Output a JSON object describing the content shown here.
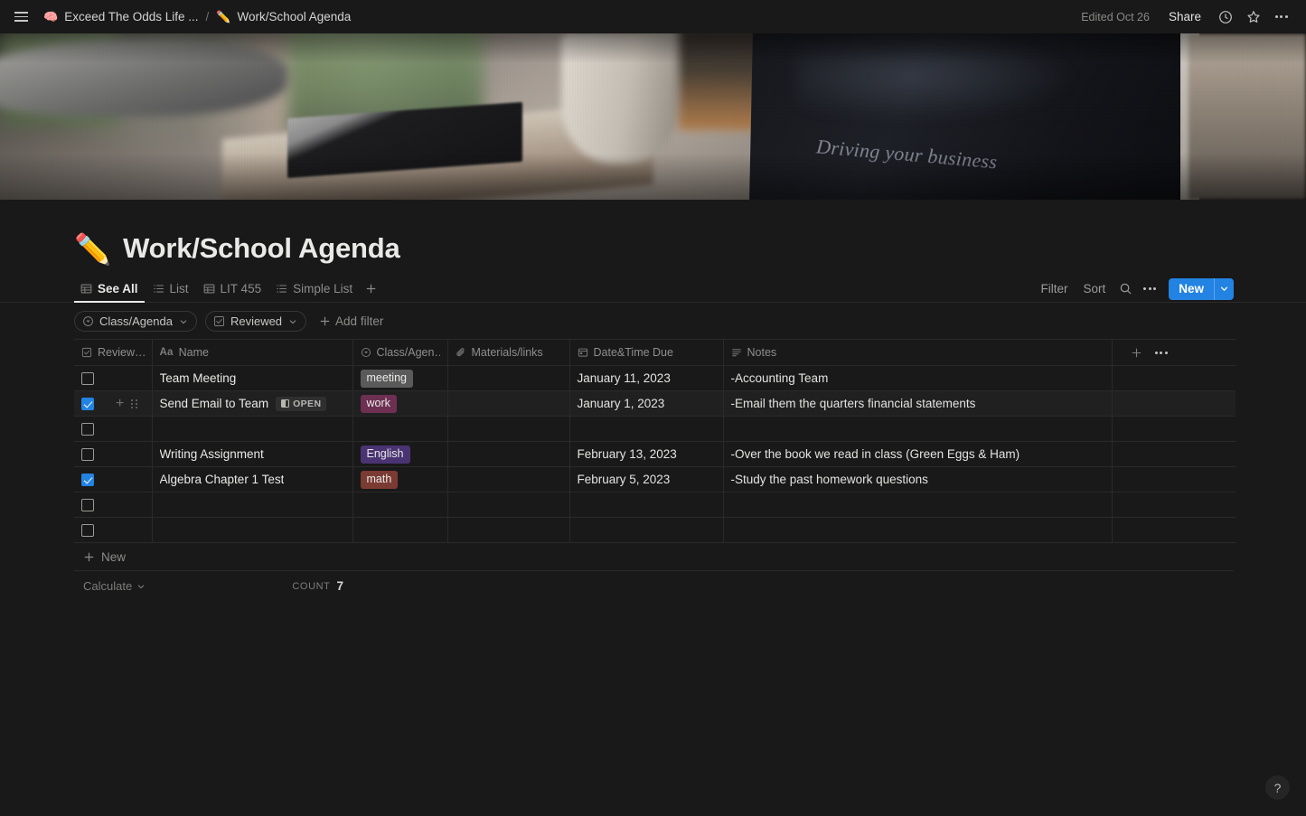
{
  "topbar": {
    "menu_icon": "hamburger-icon",
    "breadcrumb": {
      "workspace_emoji": "🧠",
      "workspace": "Exceed The Odds Life ...",
      "separator": "/",
      "page_emoji": "✏️",
      "page": "Work/School Agenda"
    },
    "edited": "Edited Oct 26",
    "share_label": "Share",
    "history_icon": "clock-icon",
    "favorite_icon": "star-icon",
    "more_icon": "more-horizontal-icon"
  },
  "cover": {
    "caption": "Driving your business"
  },
  "page": {
    "emoji": "✏️",
    "title": "Work/School Agenda"
  },
  "views": {
    "tabs": [
      {
        "label": "See All",
        "icon": "table-icon",
        "active": true
      },
      {
        "label": "List",
        "icon": "list-icon",
        "active": false
      },
      {
        "label": "LIT 455",
        "icon": "table-icon",
        "active": false
      },
      {
        "label": "Simple List",
        "icon": "list-icon",
        "active": false
      }
    ],
    "add_view_icon": "plus-icon",
    "filter_label": "Filter",
    "sort_label": "Sort",
    "search_icon": "search-icon",
    "more_icon": "more-horizontal-icon",
    "new_label": "New",
    "new_chevron_icon": "chevron-down-icon"
  },
  "filters": {
    "chips": [
      {
        "label": "Class/Agenda",
        "icon": "select-icon",
        "chevron": "chevron-down-icon"
      },
      {
        "label": "Reviewed",
        "icon": "checkbox-icon",
        "chevron": "chevron-down-icon"
      }
    ],
    "add_filter_label": "Add filter",
    "add_filter_icon": "plus-icon"
  },
  "table": {
    "columns": [
      {
        "key": "reviewed",
        "label": "Review…",
        "icon": "checkbox-icon"
      },
      {
        "key": "name",
        "label": "Name",
        "icon": "title-aa-icon"
      },
      {
        "key": "class",
        "label": "Class/Agen…",
        "icon": "select-icon"
      },
      {
        "key": "materials",
        "label": "Materials/links",
        "icon": "paperclip-icon"
      },
      {
        "key": "date",
        "label": "Date&Time Due",
        "icon": "calendar-icon"
      },
      {
        "key": "notes",
        "label": "Notes",
        "icon": "text-icon"
      }
    ],
    "header_actions": {
      "add_property_icon": "plus-icon",
      "more_icon": "more-horizontal-icon"
    },
    "rows": [
      {
        "reviewed": false,
        "name": "Team Meeting",
        "open_badge": "",
        "tag": {
          "label": "meeting",
          "color": "#5a5a5a"
        },
        "materials": "",
        "date": "January 11, 2023",
        "notes": "-Accounting Team",
        "hovered": false
      },
      {
        "reviewed": true,
        "name": "Send Email to Team",
        "open_badge": "OPEN",
        "tag": {
          "label": "work",
          "color": "#6e3052"
        },
        "materials": "",
        "date": "January 1, 2023",
        "notes": "-Email them the quarters financial statements",
        "hovered": true
      },
      {
        "reviewed": false,
        "name": "",
        "open_badge": "",
        "tag": {
          "label": "",
          "color": ""
        },
        "materials": "",
        "date": "",
        "notes": "",
        "hovered": false
      },
      {
        "reviewed": false,
        "name": "Writing Assignment",
        "open_badge": "",
        "tag": {
          "label": "English",
          "color": "#4a3372"
        },
        "materials": "",
        "date": "February 13, 2023",
        "notes": "-Over the book we read in class (Green Eggs & Ham)",
        "hovered": false
      },
      {
        "reviewed": true,
        "name": "Algebra Chapter 1 Test",
        "open_badge": "",
        "tag": {
          "label": "math",
          "color": "#7a3b33"
        },
        "materials": "",
        "date": "February 5, 2023",
        "notes": "-Study the past homework questions",
        "hovered": false
      },
      {
        "reviewed": false,
        "name": "",
        "open_badge": "",
        "tag": {
          "label": "",
          "color": ""
        },
        "materials": "",
        "date": "",
        "notes": "",
        "hovered": false
      },
      {
        "reviewed": false,
        "name": "",
        "open_badge": "",
        "tag": {
          "label": "",
          "color": ""
        },
        "materials": "",
        "date": "",
        "notes": "",
        "hovered": false
      }
    ],
    "new_row_label": "New",
    "new_row_icon": "plus-icon",
    "calculate_label": "Calculate",
    "calculate_chevron": "chevron-down-icon",
    "count_label": "Count",
    "count_value": "7"
  },
  "help": {
    "label": "?"
  },
  "colors": {
    "accent": "#2383e2",
    "background": "#191919",
    "border": "#2a2a2a",
    "text": "#e9e9e7",
    "muted": "#8c8c8a"
  }
}
